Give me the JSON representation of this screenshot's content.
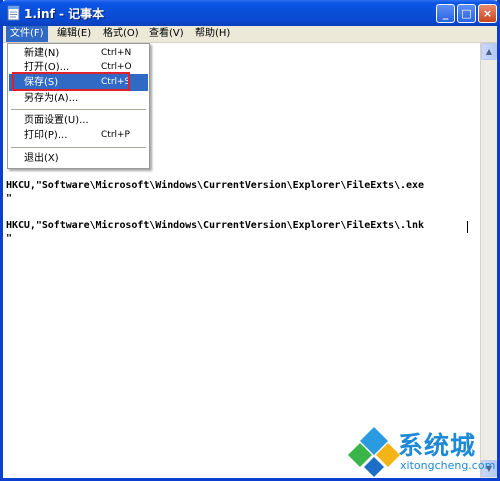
{
  "window": {
    "title": "1.inf - 记事本",
    "minimize_glyph": "_",
    "maximize_glyph": "□",
    "close_glyph": "×"
  },
  "menubar": {
    "items": [
      {
        "label": "文件(F)",
        "active": true
      },
      {
        "label": "编辑(E)",
        "active": false
      },
      {
        "label": "格式(O)",
        "active": false
      },
      {
        "label": "查看(V)",
        "active": false
      },
      {
        "label": "帮助(H)",
        "active": false
      }
    ]
  },
  "file_menu": {
    "items": [
      {
        "label": "新建(N)",
        "shortcut": "Ctrl+N",
        "selected": false
      },
      {
        "label": "打开(O)...",
        "shortcut": "Ctrl+O",
        "selected": false
      },
      {
        "label": "保存(S)",
        "shortcut": "Ctrl+S",
        "selected": true
      },
      {
        "label": "另存为(A)...",
        "shortcut": "",
        "selected": false
      },
      {
        "label": "页面设置(U)...",
        "shortcut": "",
        "selected": false
      },
      {
        "label": "打印(P)...",
        "shortcut": "Ctrl+P",
        "selected": false
      },
      {
        "label": "退出(X)",
        "shortcut": "",
        "selected": false
      }
    ]
  },
  "editor": {
    "lines": [
      "HKCU,\"Software\\Microsoft\\Windows\\CurrentVersion\\Explorer\\FileExts\\.exe",
      "\"",
      "HKCU,\"Software\\Microsoft\\Windows\\CurrentVersion\\Explorer\\FileExts\\.lnk",
      "\""
    ]
  },
  "scrollbar": {
    "up_glyph": "▲",
    "down_glyph": "▼"
  },
  "watermark": {
    "brand": "系统城",
    "url": "xitongcheng.com"
  },
  "colors": {
    "titlebar": "#0a4fd9",
    "menu_highlight": "#316ac5",
    "annotation_box": "#e0202a",
    "watermark": "#1e8ad6"
  }
}
